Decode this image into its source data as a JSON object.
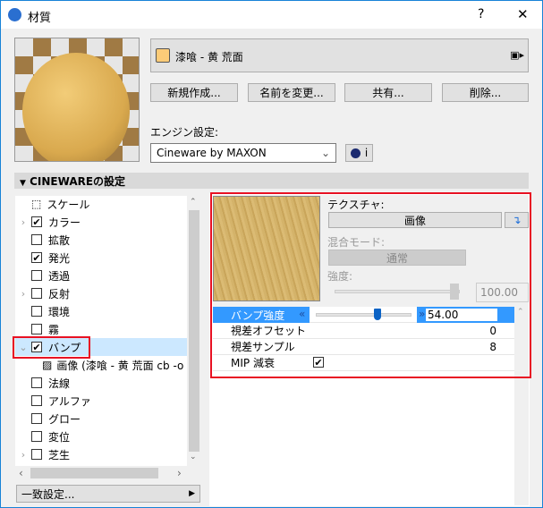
{
  "window": {
    "title": "材質",
    "help": "?",
    "close": "✕"
  },
  "material": {
    "name": "漆喰 - 黄 荒面",
    "swatch_color": "#fccb78"
  },
  "buttons": {
    "new": "新規作成...",
    "rename": "名前を変更...",
    "share": "共有...",
    "delete": "削除..."
  },
  "engine": {
    "label": "エンジン設定:",
    "value": "Cineware by MAXON",
    "info": "i"
  },
  "section": {
    "title": "CINEWAREの設定"
  },
  "tree": {
    "items": [
      {
        "label": "スケール",
        "check": null,
        "expand": ""
      },
      {
        "label": "カラー",
        "check": true,
        "expand": ">"
      },
      {
        "label": "拡散",
        "check": false,
        "expand": ""
      },
      {
        "label": "発光",
        "check": true,
        "expand": ""
      },
      {
        "label": "透過",
        "check": false,
        "expand": ""
      },
      {
        "label": "反射",
        "check": false,
        "expand": ">"
      },
      {
        "label": "環境",
        "check": false,
        "expand": ""
      },
      {
        "label": "霧",
        "check": false,
        "expand": ""
      },
      {
        "label": "バンプ",
        "check": true,
        "expand": "v"
      },
      {
        "label": "画像 (漆喰 - 黄 荒面 cb -o",
        "check": null,
        "expand": ""
      },
      {
        "label": "法線",
        "check": false,
        "expand": ""
      },
      {
        "label": "アルファ",
        "check": false,
        "expand": ""
      },
      {
        "label": "グロー",
        "check": false,
        "expand": ""
      },
      {
        "label": "変位",
        "check": false,
        "expand": ""
      },
      {
        "label": "芝生",
        "check": false,
        "expand": ">"
      }
    ]
  },
  "match_button": "一致設定...",
  "texture": {
    "label": "テクスチャ:",
    "button": "画像",
    "blend_label": "混合モード:",
    "blend_value": "通常",
    "strength_label": "強度:",
    "strength_value": "100.00",
    "strength_fraction": 1.0
  },
  "props": [
    {
      "label": "バンプ強度",
      "value": "54.00",
      "fraction": 0.54
    },
    {
      "label": "視差オフセット",
      "value": "0"
    },
    {
      "label": "視差サンプル",
      "value": "8"
    },
    {
      "label": "MIP 減衰",
      "value": "✔"
    }
  ]
}
